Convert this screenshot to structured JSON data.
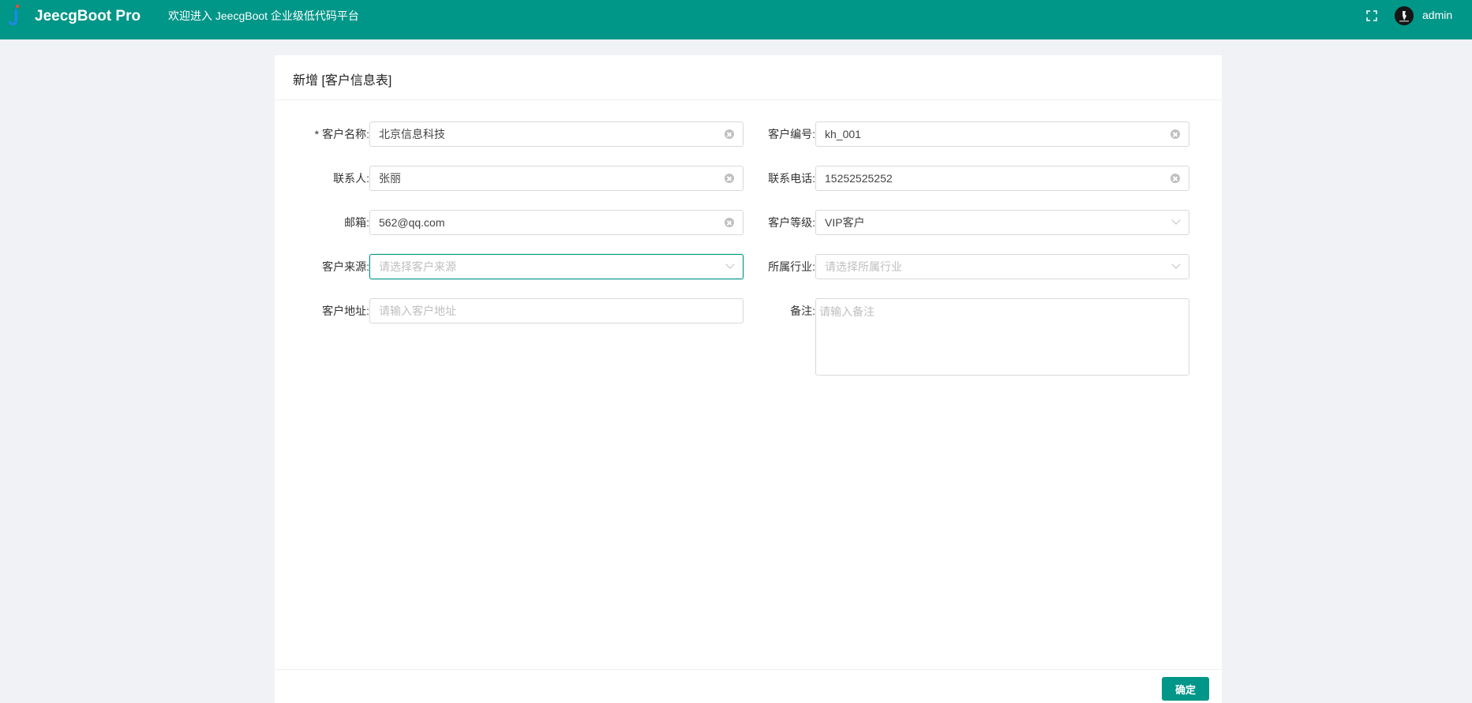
{
  "header": {
    "app_name": "JeecgBoot Pro",
    "welcome": "欢迎进入 JeecgBoot 企业级低代码平台",
    "username": "admin",
    "brand_color": "#009688"
  },
  "card": {
    "title": "新增 [客户信息表]",
    "ok_label": "确定"
  },
  "form": {
    "required_mark": "*",
    "customer_name": {
      "label": "客户名称:",
      "value": "北京信息科技"
    },
    "customer_code": {
      "label": "客户编号:",
      "value": "kh_001"
    },
    "contact": {
      "label": "联系人:",
      "value": "张丽"
    },
    "phone": {
      "label": "联系电话:",
      "value": "15252525252"
    },
    "email": {
      "label": "邮箱:",
      "value": "562@qq.com"
    },
    "level": {
      "label": "客户等级:",
      "value": "VIP客户"
    },
    "source": {
      "label": "客户来源:",
      "placeholder": "请选择客户来源"
    },
    "industry": {
      "label": "所属行业:",
      "placeholder": "请选择所属行业"
    },
    "address": {
      "label": "客户地址:",
      "placeholder": "请输入客户地址"
    },
    "remark": {
      "label": "备注:",
      "placeholder": "请输入备注"
    }
  }
}
